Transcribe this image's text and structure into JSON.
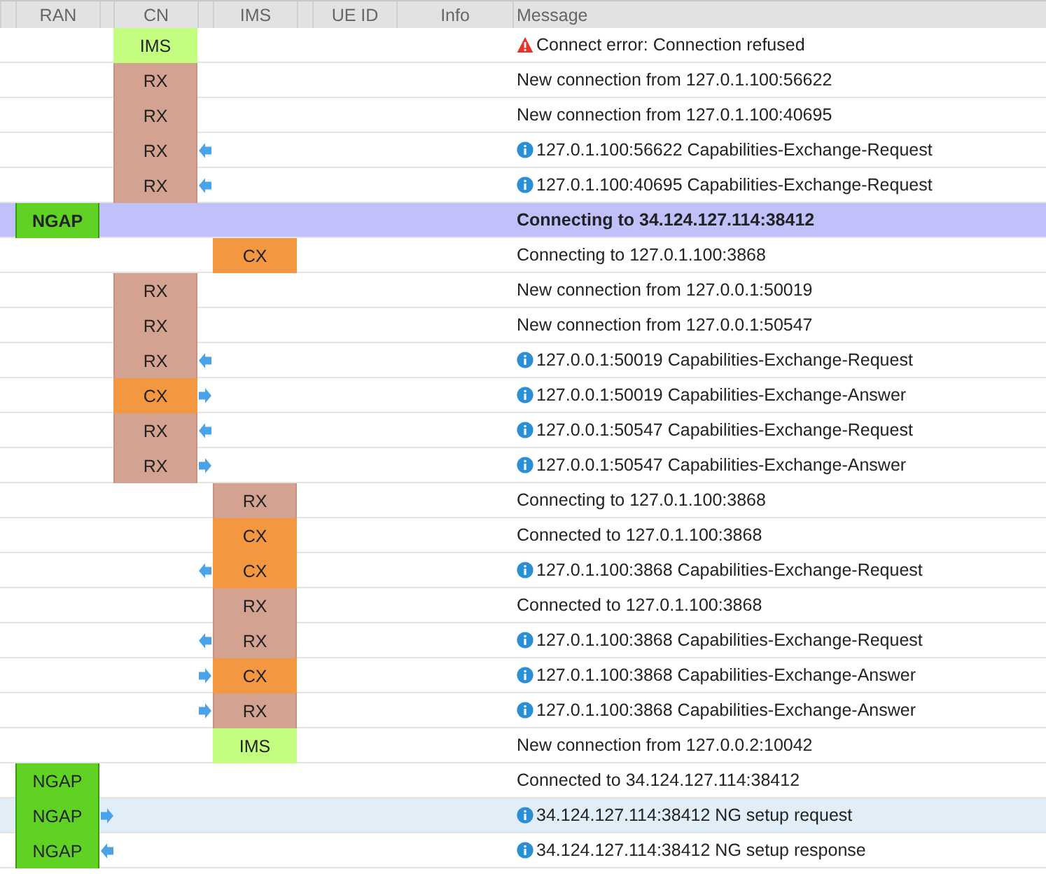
{
  "columns": [
    "RAN",
    "CN",
    "IMS",
    "UE ID",
    "Info",
    "Message"
  ],
  "rows": [
    {
      "kind": "error",
      "cn": {
        "kind": "ims",
        "label": "IMS"
      },
      "message": "Connect error: Connection refused",
      "selected": false,
      "emphasis": false
    },
    {
      "kind": "plain",
      "cn": {
        "kind": "rx",
        "label": "RX"
      },
      "message": "New connection from 127.0.1.100:56622",
      "selected": false,
      "emphasis": false
    },
    {
      "kind": "plain",
      "cn": {
        "kind": "rx",
        "label": "RX"
      },
      "message": "New connection from 127.0.1.100:40695",
      "selected": false,
      "emphasis": false
    },
    {
      "kind": "info",
      "cn": {
        "kind": "rx",
        "label": "RX"
      },
      "arrow": {
        "kind": "left"
      },
      "message": "127.0.1.100:56622 Capabilities-Exchange-Request",
      "selected": false,
      "emphasis": false
    },
    {
      "kind": "info",
      "cn": {
        "kind": "rx",
        "label": "RX"
      },
      "arrow": {
        "kind": "left"
      },
      "message": "127.0.1.100:40695 Capabilities-Exchange-Request",
      "selected": false,
      "emphasis": false
    },
    {
      "kind": "plain",
      "ran": {
        "kind": "ngap",
        "label": "NGAP"
      },
      "message": "Connecting to 34.124.127.114:38412",
      "selected": false,
      "emphasis": true
    },
    {
      "kind": "plain",
      "ims": {
        "kind": "cx",
        "label": "CX"
      },
      "message": "Connecting to 127.0.1.100:3868",
      "selected": false,
      "emphasis": false
    },
    {
      "kind": "plain",
      "cn": {
        "kind": "rx",
        "label": "RX"
      },
      "message": "New connection from 127.0.0.1:50019",
      "selected": false,
      "emphasis": false
    },
    {
      "kind": "plain",
      "cn": {
        "kind": "rx",
        "label": "RX"
      },
      "message": "New connection from 127.0.0.1:50547",
      "selected": false,
      "emphasis": false
    },
    {
      "kind": "info",
      "cn": {
        "kind": "rx",
        "label": "RX"
      },
      "arrow": {
        "kind": "left"
      },
      "message": "127.0.0.1:50019 Capabilities-Exchange-Request",
      "selected": false,
      "emphasis": false
    },
    {
      "kind": "info",
      "cn": {
        "kind": "cx",
        "label": "CX"
      },
      "arrow": {
        "kind": "right"
      },
      "message": "127.0.0.1:50019 Capabilities-Exchange-Answer",
      "selected": false,
      "emphasis": false
    },
    {
      "kind": "info",
      "cn": {
        "kind": "rx",
        "label": "RX"
      },
      "arrow": {
        "kind": "left"
      },
      "message": "127.0.0.1:50547 Capabilities-Exchange-Request",
      "selected": false,
      "emphasis": false
    },
    {
      "kind": "info",
      "cn": {
        "kind": "rx",
        "label": "RX"
      },
      "arrow": {
        "kind": "right"
      },
      "message": "127.0.0.1:50547 Capabilities-Exchange-Answer",
      "selected": false,
      "emphasis": false
    },
    {
      "kind": "plain",
      "ims": {
        "kind": "rx",
        "label": "RX"
      },
      "message": "Connecting to 127.0.1.100:3868",
      "selected": false,
      "emphasis": false
    },
    {
      "kind": "plain",
      "ims": {
        "kind": "cx",
        "label": "CX"
      },
      "message": "Connected to 127.0.1.100:3868",
      "selected": false,
      "emphasis": false
    },
    {
      "kind": "info",
      "ims": {
        "kind": "cx",
        "label": "CX"
      },
      "arrow": {
        "kind": "left"
      },
      "message": "127.0.1.100:3868 Capabilities-Exchange-Request",
      "selected": false,
      "emphasis": false
    },
    {
      "kind": "plain",
      "ims": {
        "kind": "rx",
        "label": "RX"
      },
      "message": "Connected to 127.0.1.100:3868",
      "selected": false,
      "emphasis": false
    },
    {
      "kind": "info",
      "ims": {
        "kind": "rx",
        "label": "RX"
      },
      "arrow": {
        "kind": "left"
      },
      "message": "127.0.1.100:3868 Capabilities-Exchange-Request",
      "selected": false,
      "emphasis": false
    },
    {
      "kind": "info",
      "ims": {
        "kind": "cx",
        "label": "CX"
      },
      "arrow": {
        "kind": "right"
      },
      "message": "127.0.1.100:3868 Capabilities-Exchange-Answer",
      "selected": false,
      "emphasis": false
    },
    {
      "kind": "info",
      "ims": {
        "kind": "rx",
        "label": "RX"
      },
      "arrow": {
        "kind": "right"
      },
      "message": "127.0.1.100:3868 Capabilities-Exchange-Answer",
      "selected": false,
      "emphasis": false
    },
    {
      "kind": "plain",
      "ims": {
        "kind": "ims",
        "label": "IMS"
      },
      "message": "New connection from 127.0.0.2:10042",
      "selected": false,
      "emphasis": false
    },
    {
      "kind": "plain",
      "ran": {
        "kind": "ngap",
        "label": "NGAP"
      },
      "message": "Connected to 34.124.127.114:38412",
      "selected": false,
      "emphasis": false
    },
    {
      "kind": "info",
      "ran": {
        "kind": "ngap",
        "label": "NGAP"
      },
      "arrow": {
        "kind": "right"
      },
      "message": "34.124.127.114:38412 NG setup request",
      "selected": true,
      "emphasis": false
    },
    {
      "kind": "info",
      "ran": {
        "kind": "ngap",
        "label": "NGAP"
      },
      "arrow": {
        "kind": "left"
      },
      "message": "34.124.127.114:38412 NG setup response",
      "selected": false,
      "emphasis": false
    }
  ]
}
